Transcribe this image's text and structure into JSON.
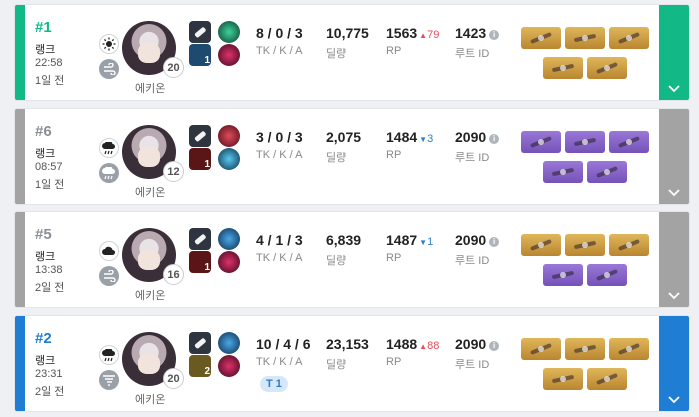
{
  "colors": {
    "win": "#12b886",
    "first_blue": "#1f7dd3",
    "neutral_gray": "#a3a3a3",
    "rank_green": "#12b886",
    "rank_gray": "#8a8f96",
    "rank_blue": "#1f7dd3"
  },
  "labels": {
    "kda": "TK / K / A",
    "damage": "딜량",
    "rp": "RP",
    "route": "루트 ID",
    "info": "i"
  },
  "matches": [
    {
      "rank": "#1",
      "mode": "랭크",
      "time": "22:58",
      "ago": "1일 전",
      "weather1": "sun-icon",
      "weather2": "wind-icon",
      "character": "에키온",
      "level": "20",
      "skill_count": "1",
      "kda": "8 / 0 / 3",
      "damage": "10,775",
      "rp": "1563",
      "rp_delta": "79",
      "rp_dir": "up",
      "route": "1423",
      "tier": "",
      "items": [
        "gold",
        "gold",
        "gold",
        "gold",
        "gold"
      ]
    },
    {
      "rank": "#6",
      "mode": "랭크",
      "time": "08:57",
      "ago": "1일 전",
      "weather1": "rain-cloud-icon",
      "weather2": "rain-cloud-icon",
      "character": "에키온",
      "level": "12",
      "skill_count": "1",
      "kda": "3 / 0 / 3",
      "damage": "2,075",
      "rp": "1484",
      "rp_delta": "3",
      "rp_dir": "down",
      "route": "2090",
      "tier": "",
      "items": [
        "purple",
        "purple",
        "purple",
        "purple",
        "purple"
      ]
    },
    {
      "rank": "#5",
      "mode": "랭크",
      "time": "13:38",
      "ago": "2일 전",
      "weather1": "cloud-icon",
      "weather2": "wind-icon",
      "character": "에키온",
      "level": "16",
      "skill_count": "1",
      "kda": "4 / 1 / 3",
      "damage": "6,839",
      "rp": "1487",
      "rp_delta": "1",
      "rp_dir": "down",
      "route": "2090",
      "tier": "",
      "items": [
        "gold",
        "gold",
        "gold",
        "purple",
        "purple"
      ]
    },
    {
      "rank": "#2",
      "mode": "랭크",
      "time": "23:31",
      "ago": "2일 전",
      "weather1": "rain-cloud-icon",
      "weather2": "tornado-icon",
      "character": "에키온",
      "level": "20",
      "skill_count": "2",
      "kda": "10 / 4 / 6",
      "damage": "23,153",
      "rp": "1488",
      "rp_delta": "88",
      "rp_dir": "up",
      "route": "2090",
      "tier": "T 1",
      "items": [
        "gold",
        "gold",
        "gold",
        "gold",
        "gold"
      ]
    }
  ]
}
